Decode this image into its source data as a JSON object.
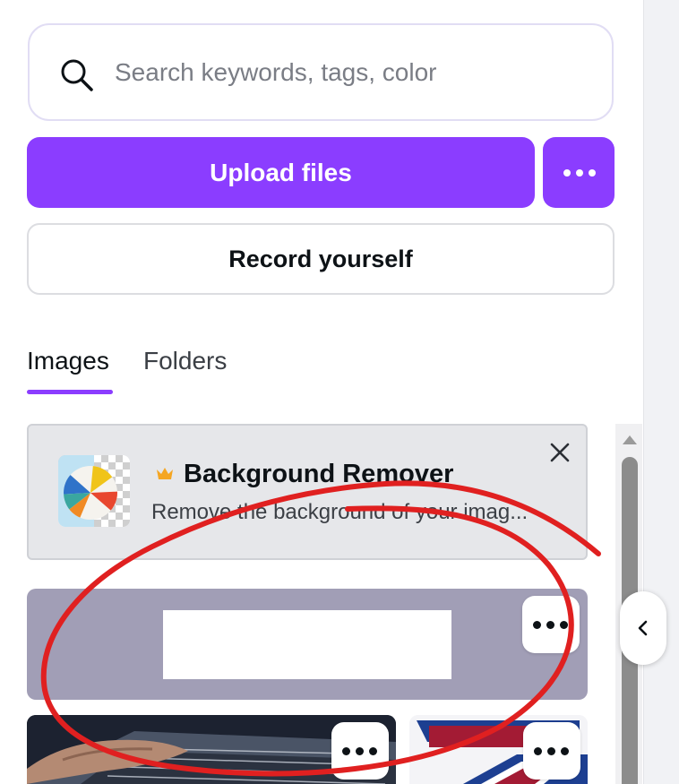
{
  "search": {
    "placeholder": "Search keywords, tags, color",
    "icon": "search-icon"
  },
  "actions": {
    "upload_label": "Upload files",
    "more_icon": "more-horizontal-icon",
    "record_label": "Record yourself"
  },
  "tabs": [
    {
      "label": "Images",
      "active": true
    },
    {
      "label": "Folders",
      "active": false
    }
  ],
  "promo": {
    "title": "Background Remover",
    "description": "Remove the background of your imag...",
    "icons": {
      "crown": "crown-icon",
      "close": "close-icon",
      "thumbnail": "beach-ball-thumbnail"
    }
  },
  "colors": {
    "accent": "#8b3dff",
    "annotation": "#e02020",
    "promo_bg": "#e6e7ea"
  },
  "uploads": [
    {
      "name": "white-box-upload"
    },
    {
      "name": "keyboard-photo-upload"
    },
    {
      "name": "logo-upload"
    }
  ]
}
